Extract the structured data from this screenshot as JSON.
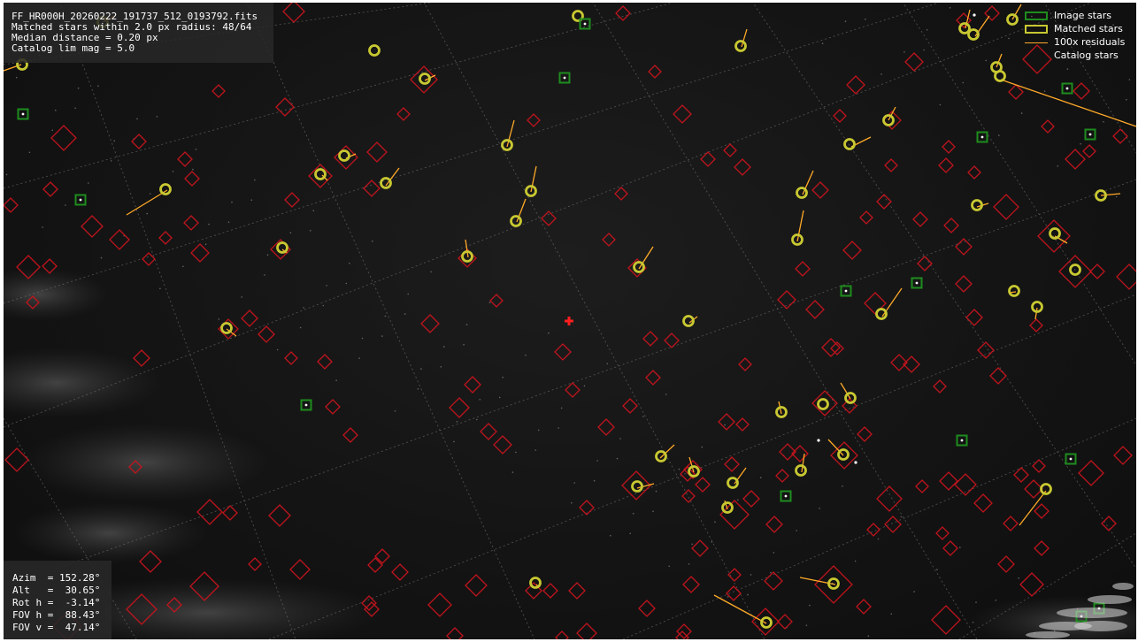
{
  "info": {
    "filename": "FF_HR000H_20260222_191737_512_0193792.fits",
    "matched": "Matched stars within 2.0 px radius: 48/64",
    "median": "Median distance = 0.20 px",
    "limmag": "Catalog lim mag = 5.0"
  },
  "pointing": {
    "azim": "Azim  = 152.28°",
    "alt": "Alt   =  30.65°",
    "roth": "Rot h =  -3.14°",
    "fovh": "FOV h =  88.43°",
    "fovv": "FOV v =  47.14°"
  },
  "legend": {
    "image_stars": "Image stars",
    "matched_stars": "Matched stars",
    "residuals": "100x residuals",
    "catalog_stars": "Catalog stars"
  },
  "colors": {
    "catalog": "#c8141e",
    "matched": "#c8c832",
    "residual": "#ffaa28",
    "image": "#1e8c1e",
    "center": "#ff1e1e",
    "grid": "#707070"
  },
  "icons": {
    "center_marker": "red-cross-icon"
  }
}
